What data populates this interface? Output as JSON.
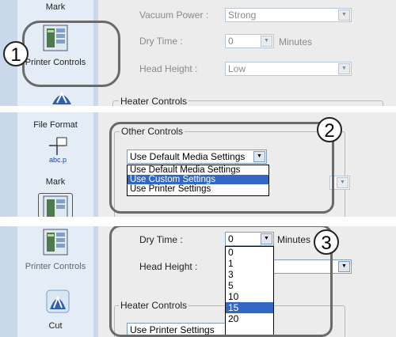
{
  "panel1": {
    "sidebar": {
      "mark_label": "Mark",
      "printer_controls_label": "Printer Controls"
    },
    "vacuum_power": {
      "label": "Vacuum Power :",
      "value": "Strong"
    },
    "dry_time": {
      "label": "Dry Time :",
      "value": "0",
      "unit": "Minutes"
    },
    "head_height": {
      "label": "Head Height :",
      "value": "Low"
    },
    "heater_controls_title": "Heater Controls",
    "callout_number": "1"
  },
  "panel2": {
    "sidebar": {
      "file_format_label": "File Format",
      "mark_label": "Mark"
    },
    "other_controls_title": "Other Controls",
    "media_settings": {
      "value": "Use Default Media Settings",
      "options": [
        "Use Default Media Settings",
        "Use Custom Settings",
        "Use Printer Settings"
      ],
      "highlighted": "Use Custom Settings"
    },
    "callout_number": "2"
  },
  "panel3": {
    "sidebar": {
      "printer_controls_label": "Printer Controls",
      "cut_label": "Cut"
    },
    "dry_time": {
      "label": "Dry Time :",
      "value": "0",
      "unit": "Minutes",
      "options": [
        "0",
        "1",
        "3",
        "5",
        "10",
        "15",
        "20"
      ],
      "highlighted": "15"
    },
    "head_height": {
      "label": "Head Height :"
    },
    "heater_controls_title": "Heater Controls",
    "bottom_combo_value": "Use Printer Settings",
    "callout_number": "3"
  }
}
